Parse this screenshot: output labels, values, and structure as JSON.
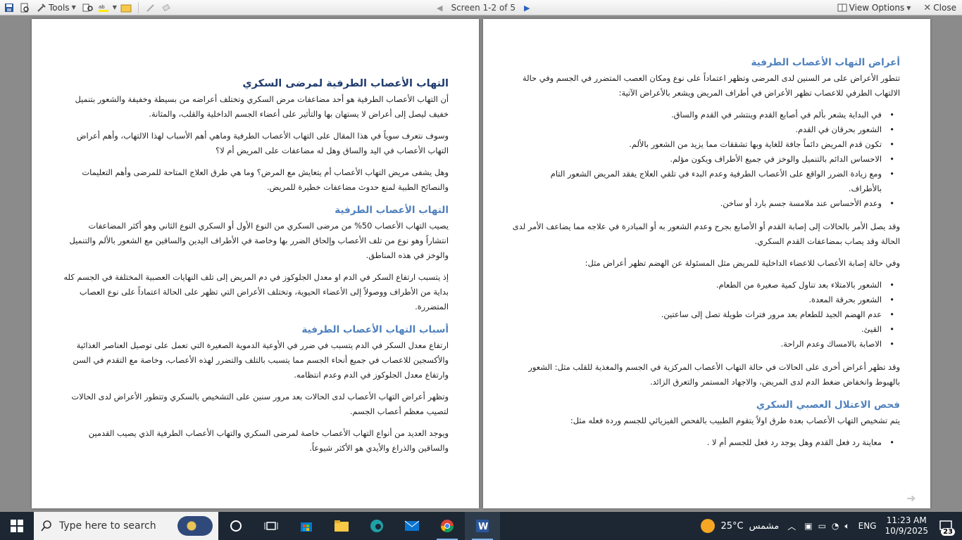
{
  "toolbar": {
    "tools_label": "Tools",
    "screen_label": "Screen 1-2 of 5",
    "view_options_label": "View Options",
    "close_label": "Close"
  },
  "page_left": {
    "title": "التهاب الأعصاب الطرفية لمرضى السكري",
    "intro_paragraphs": [
      "أن التهاب الأعصاب الطرفية هو أحد مضاعفات مرض السكري وتختلف أعراضه من بسيطة وخفيفة والشعور بتنميل خفيف ليصل إلى أعراض لا يستهان بها والتأثير على أعضاء الجسم الداخلية والقلب، والمثانة.",
      "وسوف نتعرف سوياً في هذا المقال على التهاب الأعصاب الطرفية وماهي أهم الأسباب لهذا الالتهاب، وأهم أعراض التهاب الأعصاب في اليد والساق وهل له مضاعفات على المريض أم لا؟",
      "وهل يشفى مريض التهاب الأعصاب أم يتعايش مع المرض؟ وما هي طرق العلاج المتاحة للمرضى وأهم التعليمات والنصائح الطبية لمنع حدوث مضاعفات خطيرة للمريض."
    ],
    "section1_heading": "التهاب الأعصاب الطرفية",
    "section1_paragraphs": [
      "يصيب التهاب الأعصاب 50% من مرضى السكري من النوع الأول أو السكري النوع الثاني وهو أكثر المضاعفات انتشاراً وهو نوع من تلف الأعصاب وإلحاق الضرر بها وخاصة في الأطراف اليدين والساقين مع الشعور بالألم والتنميل والوخز في هذه المناطق.",
      "إذ يتسبب ارتفاع السكر في الدم او معدل الجلوكوز في دم المريض إلى تلف النهايات العصبية المختلفة في الجسم كله بداية من الأطراف ووصولاً إلى الأعضاء الحيوية، وتختلف الأعراض التي تظهر على الحالة اعتماداً على نوع العصاب المتضررة."
    ],
    "section2_heading": "أسباب التهاب الأعصاب الطرفية",
    "section2_paragraphs": [
      "ارتفاع معدل السكر في الدم يتسبب في ضرر في الأوعية الدموية الصغيرة التي تعمل على توصيل العناصر الغذائية والأكسجين للاعصاب في جميع أنحاء الجسم مما يتسبب بالتلف والتضرر لهذه الأعصاب، وخاصة مع التقدم في السن وارتفاع معدل الجلوكوز في الدم وعدم انتظامه.",
      "وتظهر أعراض التهاب الأعصاب لدى الحالات بعد مرور سنين على التشخيص بالسكري وتتطور الأعراض لدى الحالات لتصيب معظم أعصاب الجسم.",
      "ويوجد العديد من أنواع التهاب الأعصاب خاصة لمرضى السكري والتهاب الأعصاب الطرفية الذي يصيب القدمين والساقين والذراع والأيدي هو الأكثر شيوعاً."
    ]
  },
  "page_right": {
    "section1_heading": "أعراض التهاب الأعصاب الطرفية",
    "section1_intro": "تتطور الأعراض على مر السنين لدى المرضى وتظهر اعتماداً على نوع ومكان العصب المتضرر في الجسم وفي حالة الالتهاب الطرفي للاعصاب تظهر الأعراض في أطراف المريض ويشعر بالأعراض الآتية:",
    "symptoms": [
      "في البداية يشعر بألم في أصابع القدم وينتشر في القدم والساق.",
      "الشعور بحرقان في القدم.",
      "تكون قدم المريض دائماً جافة للغاية وبها تشققات مما يزيد من الشعور بالألم.",
      "الاحساس الدائم بالتنميل والوخز في جميع الأطراف ويكون مؤلم.",
      "ومع زيادة الضرر الواقع على الأعصاب الطرفية وعدم البدء في تلقي العلاج يفقد المريض الشعور التام بالأطراف.",
      "وعدم الأحساس عند ملامسة جسم بارد أو ساخن."
    ],
    "para_after_symptoms": "وقد يصل الأمر بالحالات إلى إصابة القدم أو الأصابع بجرح وعدم الشعور به أو المبادرة في علاجه مما يضاعف الأمر لدى الحالة وقد يصاب بمضاعفات القدم السكري.",
    "para_digestive_intro": "وفي حالة إصابة الأعصاب للاعضاء الداخلية للمريض مثل المسئولة عن الهضم تظهر أعراض مثل:",
    "digestive_symptoms": [
      "الشعور بالامتلاء بعد تناول كمية صغيرة من الطعام.",
      "الشعور بحرقة المعدة.",
      "عدم الهضم الجيد للطعام بعد مرور فترات طويلة تصل إلى ساعتين.",
      "القيئ.",
      "الاصابة بالامساك وعدم الراحة."
    ],
    "para_central": "وقد تظهر أعراض أخرى على الحالات في حالة التهاب الأعصاب المركزية في الجسم والمغذية للقلب مثل: الشعور بالهبوط وانخفاض ضغط الدم لدى المريض، والاجهاد المستمر والتعرق الزائد.",
    "section2_heading": "فحص الاعتلال العصبي السكري",
    "section2_intro": "يتم تشخيص التهاب الأعصاب بعدة طرق اولاً يتقوم الطبيب بالفحص الفيزيائي للجسم وردة فعله مثل:",
    "exam_items": [
      "معاينة رد فعل القدم وهل يوجد رد فعل للجسم أم لا ."
    ]
  },
  "taskbar": {
    "search_placeholder": "Type here to search",
    "weather_temp": "25°C",
    "weather_desc": "مشمس",
    "language": "ENG",
    "time": "11:23 AM",
    "date": "10/9/2025",
    "notification_count": "23"
  }
}
